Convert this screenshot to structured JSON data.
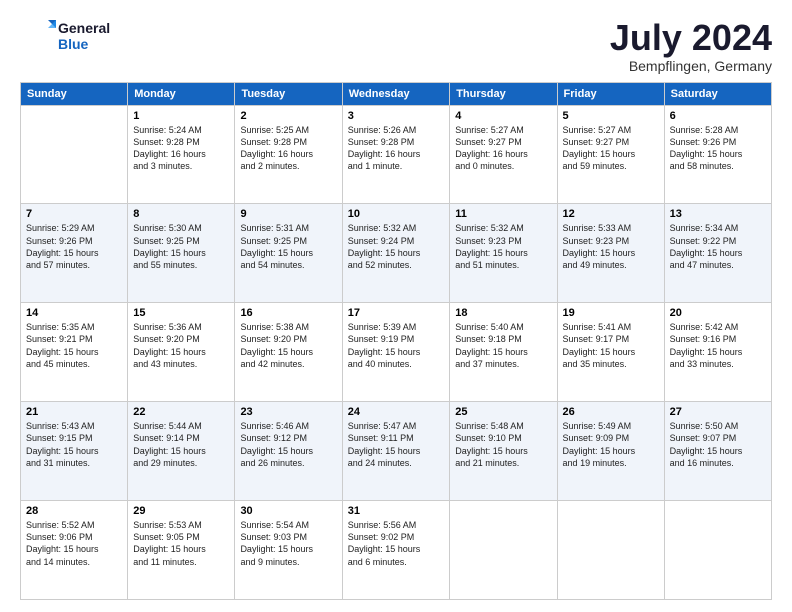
{
  "logo": {
    "line1": "General",
    "line2": "Blue"
  },
  "title": "July 2024",
  "location": "Bempflingen, Germany",
  "weekdays": [
    "Sunday",
    "Monday",
    "Tuesday",
    "Wednesday",
    "Thursday",
    "Friday",
    "Saturday"
  ],
  "weeks": [
    [
      {
        "day": "",
        "info": ""
      },
      {
        "day": "1",
        "info": "Sunrise: 5:24 AM\nSunset: 9:28 PM\nDaylight: 16 hours\nand 3 minutes."
      },
      {
        "day": "2",
        "info": "Sunrise: 5:25 AM\nSunset: 9:28 PM\nDaylight: 16 hours\nand 2 minutes."
      },
      {
        "day": "3",
        "info": "Sunrise: 5:26 AM\nSunset: 9:28 PM\nDaylight: 16 hours\nand 1 minute."
      },
      {
        "day": "4",
        "info": "Sunrise: 5:27 AM\nSunset: 9:27 PM\nDaylight: 16 hours\nand 0 minutes."
      },
      {
        "day": "5",
        "info": "Sunrise: 5:27 AM\nSunset: 9:27 PM\nDaylight: 15 hours\nand 59 minutes."
      },
      {
        "day": "6",
        "info": "Sunrise: 5:28 AM\nSunset: 9:26 PM\nDaylight: 15 hours\nand 58 minutes."
      }
    ],
    [
      {
        "day": "7",
        "info": "Sunrise: 5:29 AM\nSunset: 9:26 PM\nDaylight: 15 hours\nand 57 minutes."
      },
      {
        "day": "8",
        "info": "Sunrise: 5:30 AM\nSunset: 9:25 PM\nDaylight: 15 hours\nand 55 minutes."
      },
      {
        "day": "9",
        "info": "Sunrise: 5:31 AM\nSunset: 9:25 PM\nDaylight: 15 hours\nand 54 minutes."
      },
      {
        "day": "10",
        "info": "Sunrise: 5:32 AM\nSunset: 9:24 PM\nDaylight: 15 hours\nand 52 minutes."
      },
      {
        "day": "11",
        "info": "Sunrise: 5:32 AM\nSunset: 9:23 PM\nDaylight: 15 hours\nand 51 minutes."
      },
      {
        "day": "12",
        "info": "Sunrise: 5:33 AM\nSunset: 9:23 PM\nDaylight: 15 hours\nand 49 minutes."
      },
      {
        "day": "13",
        "info": "Sunrise: 5:34 AM\nSunset: 9:22 PM\nDaylight: 15 hours\nand 47 minutes."
      }
    ],
    [
      {
        "day": "14",
        "info": "Sunrise: 5:35 AM\nSunset: 9:21 PM\nDaylight: 15 hours\nand 45 minutes."
      },
      {
        "day": "15",
        "info": "Sunrise: 5:36 AM\nSunset: 9:20 PM\nDaylight: 15 hours\nand 43 minutes."
      },
      {
        "day": "16",
        "info": "Sunrise: 5:38 AM\nSunset: 9:20 PM\nDaylight: 15 hours\nand 42 minutes."
      },
      {
        "day": "17",
        "info": "Sunrise: 5:39 AM\nSunset: 9:19 PM\nDaylight: 15 hours\nand 40 minutes."
      },
      {
        "day": "18",
        "info": "Sunrise: 5:40 AM\nSunset: 9:18 PM\nDaylight: 15 hours\nand 37 minutes."
      },
      {
        "day": "19",
        "info": "Sunrise: 5:41 AM\nSunset: 9:17 PM\nDaylight: 15 hours\nand 35 minutes."
      },
      {
        "day": "20",
        "info": "Sunrise: 5:42 AM\nSunset: 9:16 PM\nDaylight: 15 hours\nand 33 minutes."
      }
    ],
    [
      {
        "day": "21",
        "info": "Sunrise: 5:43 AM\nSunset: 9:15 PM\nDaylight: 15 hours\nand 31 minutes."
      },
      {
        "day": "22",
        "info": "Sunrise: 5:44 AM\nSunset: 9:14 PM\nDaylight: 15 hours\nand 29 minutes."
      },
      {
        "day": "23",
        "info": "Sunrise: 5:46 AM\nSunset: 9:12 PM\nDaylight: 15 hours\nand 26 minutes."
      },
      {
        "day": "24",
        "info": "Sunrise: 5:47 AM\nSunset: 9:11 PM\nDaylight: 15 hours\nand 24 minutes."
      },
      {
        "day": "25",
        "info": "Sunrise: 5:48 AM\nSunset: 9:10 PM\nDaylight: 15 hours\nand 21 minutes."
      },
      {
        "day": "26",
        "info": "Sunrise: 5:49 AM\nSunset: 9:09 PM\nDaylight: 15 hours\nand 19 minutes."
      },
      {
        "day": "27",
        "info": "Sunrise: 5:50 AM\nSunset: 9:07 PM\nDaylight: 15 hours\nand 16 minutes."
      }
    ],
    [
      {
        "day": "28",
        "info": "Sunrise: 5:52 AM\nSunset: 9:06 PM\nDaylight: 15 hours\nand 14 minutes."
      },
      {
        "day": "29",
        "info": "Sunrise: 5:53 AM\nSunset: 9:05 PM\nDaylight: 15 hours\nand 11 minutes."
      },
      {
        "day": "30",
        "info": "Sunrise: 5:54 AM\nSunset: 9:03 PM\nDaylight: 15 hours\nand 9 minutes."
      },
      {
        "day": "31",
        "info": "Sunrise: 5:56 AM\nSunset: 9:02 PM\nDaylight: 15 hours\nand 6 minutes."
      },
      {
        "day": "",
        "info": ""
      },
      {
        "day": "",
        "info": ""
      },
      {
        "day": "",
        "info": ""
      }
    ]
  ]
}
